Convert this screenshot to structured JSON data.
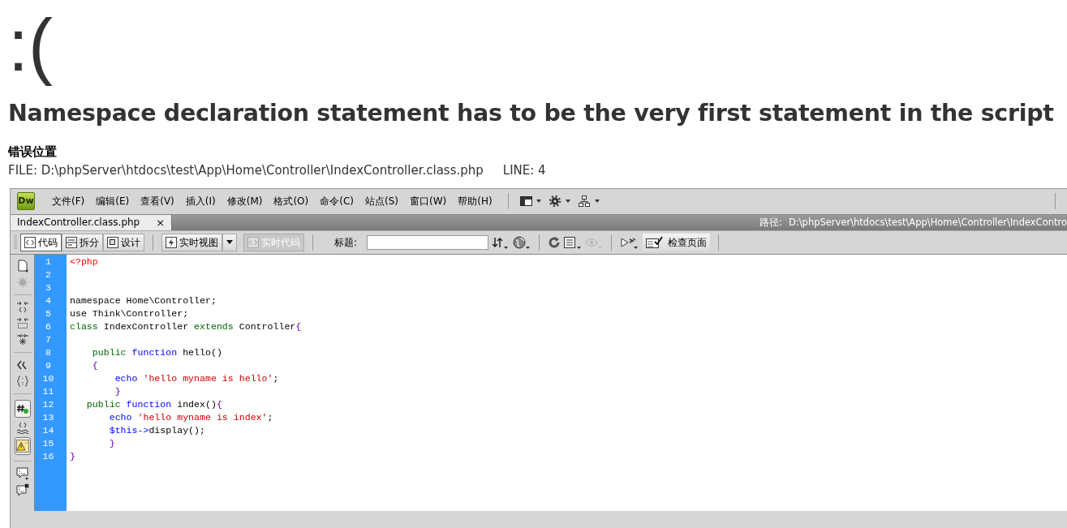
{
  "face": ":(",
  "message": "Namespace declaration statement has to be the very first statement in the script",
  "error_location": {
    "label": "错误位置",
    "file": "FILE: D:\\phpServer\\htdocs\\test\\App\\Home\\Controller\\IndexController.class.php",
    "line": "LINE: 4"
  },
  "editor": {
    "logo": "Dw",
    "menu": [
      "文件(F)",
      "编辑(E)",
      "查看(V)",
      "插入(I)",
      "修改(M)",
      "格式(O)",
      "命令(C)",
      "站点(S)",
      "窗口(W)",
      "帮助(H)"
    ],
    "tabs": [
      {
        "label": "IndexController.class.php",
        "close": "×",
        "selected": true
      }
    ],
    "path": {
      "label": "路径:",
      "value": "D:\\phpServer\\htdocs\\test\\App\\Home\\Controller\\IndexContro"
    },
    "view_buttons": [
      {
        "label": "代码",
        "selected": true
      },
      {
        "label": "拆分",
        "selected": false
      },
      {
        "label": "设计",
        "selected": false
      }
    ],
    "live_view": {
      "label": "实时视图"
    },
    "live_code": {
      "label": "实时代码",
      "disabled": true
    },
    "title_field": {
      "label": "标题:"
    },
    "check_page": {
      "label": "检查页面"
    },
    "side_toggles": [
      {
        "on": true
      },
      {
        "on": true
      }
    ],
    "code_lines": [
      {
        "number": "1",
        "segments": [
          {
            "kind": "tag",
            "text": "<?php"
          }
        ]
      },
      {
        "number": "2"
      },
      {
        "number": "3"
      },
      {
        "number": "4",
        "segments": [
          {
            "kind": "plain",
            "text": "namespace Home\\Controller;"
          }
        ]
      },
      {
        "number": "5",
        "segments": [
          {
            "kind": "plain",
            "text": "use Think\\Controller;"
          }
        ]
      },
      {
        "number": "6",
        "segments": [
          {
            "kind": "keyword",
            "text": "class"
          },
          {
            "kind": "plain",
            "text": " IndexController "
          },
          {
            "kind": "keyword",
            "text": "extends"
          },
          {
            "kind": "plain",
            "text": " Controller"
          },
          {
            "kind": "brace",
            "text": "{"
          }
        ]
      },
      {
        "number": "7"
      },
      {
        "number": "8",
        "segments": [
          {
            "kind": "keyword",
            "text": "    public"
          },
          {
            "kind": "function",
            "text": " function"
          },
          {
            "kind": "plain",
            "text": " hello()"
          }
        ]
      },
      {
        "number": "9",
        "segments": [
          {
            "kind": "brace",
            "text": "    {"
          }
        ]
      },
      {
        "number": "10",
        "segments": [
          {
            "kind": "function",
            "text": "        echo"
          },
          {
            "kind": "string",
            "text": " 'hello myname is hello'"
          },
          {
            "kind": "plain",
            "text": ";"
          }
        ]
      },
      {
        "number": "11",
        "segments": [
          {
            "kind": "brace",
            "text": "        }"
          }
        ]
      },
      {
        "number": "12",
        "segments": [
          {
            "kind": "keyword",
            "text": "   public"
          },
          {
            "kind": "function",
            "text": " function"
          },
          {
            "kind": "plain",
            "text": " index()"
          },
          {
            "kind": "brace",
            "text": "{"
          }
        ]
      },
      {
        "number": "13",
        "segments": [
          {
            "kind": "function",
            "text": "       echo"
          },
          {
            "kind": "string",
            "text": " 'hello myname is index'"
          },
          {
            "kind": "plain",
            "text": ";"
          }
        ]
      },
      {
        "number": "14",
        "segments": [
          {
            "kind": "function",
            "text": "       $this->"
          },
          {
            "kind": "plain",
            "text": "display();"
          }
        ]
      },
      {
        "number": "15",
        "segments": [
          {
            "kind": "brace",
            "text": "       }"
          }
        ]
      },
      {
        "number": "16",
        "segments": [
          {
            "kind": "brace",
            "text": "}"
          }
        ]
      }
    ]
  }
}
